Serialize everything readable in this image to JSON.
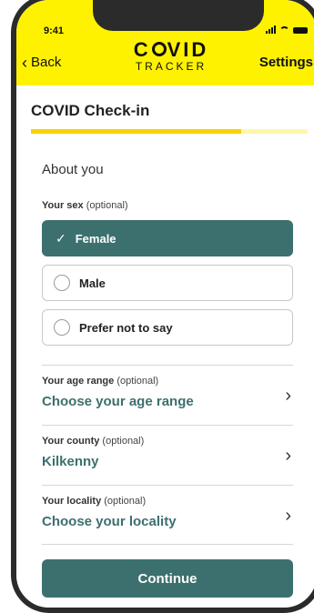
{
  "status_bar": {
    "time": "9:41"
  },
  "header": {
    "back_label": "Back",
    "logo_line1_prefix": "C",
    "logo_line1_suffix": "VID",
    "logo_line2": "TRACKER",
    "settings_label": "Settings",
    "background_color": "#fff200"
  },
  "page": {
    "title": "COVID Check-in",
    "progress_fraction": 0.76
  },
  "about": {
    "section_title": "About you",
    "sex_label": "Your sex",
    "optional_text": "(optional)",
    "options": [
      {
        "label": "Female",
        "selected": true
      },
      {
        "label": "Male",
        "selected": false
      },
      {
        "label": "Prefer not to say",
        "selected": false
      }
    ]
  },
  "rows": [
    {
      "label": "Your age range",
      "optional": "(optional)",
      "value": "Choose your age range"
    },
    {
      "label": "Your county",
      "optional": "(optional)",
      "value": "Kilkenny"
    },
    {
      "label": "Your locality",
      "optional": "(optional)",
      "value": "Choose your locality"
    }
  ],
  "continue_label": "Continue",
  "accent_color": "#3c706e"
}
